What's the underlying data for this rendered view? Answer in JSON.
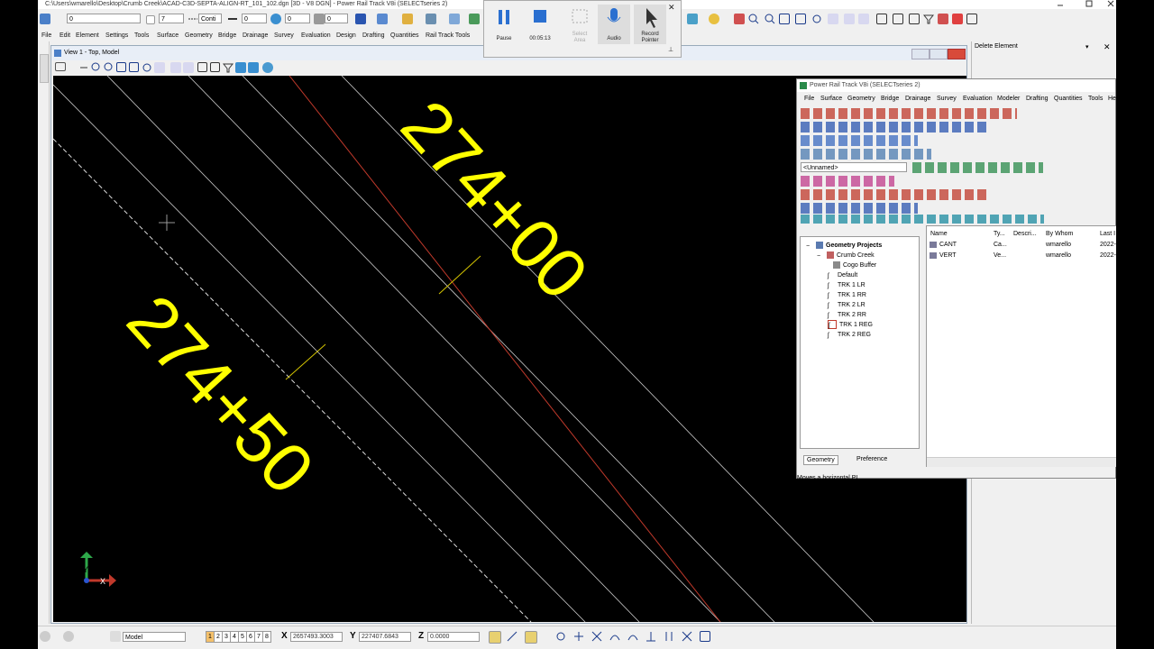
{
  "app": {
    "title": "C:\\Users\\wmarello\\Desktop\\Crumb Creek\\ACAD-C3D-SEPTA-ALIGN-RT_101_102.dgn [3D - V8 DGN] - Power Rail Track V8i (SELECTseries 2)"
  },
  "toolbar": {
    "level_value": "0",
    "color_value": "7",
    "style_value": "Conti",
    "weight_value": "0",
    "trans_value": "0",
    "prio_value": "0"
  },
  "menu": [
    "File",
    "Edit",
    "Element",
    "Settings",
    "Tools",
    "Surface",
    "Geometry",
    "Bridge",
    "Drainage",
    "Survey",
    "Evaluation",
    "Design",
    "Drafting",
    "Quantities",
    "Rail Track Tools"
  ],
  "recorder": {
    "pause": "Pause",
    "time": "00:05:13",
    "select_area_1": "Select",
    "select_area_2": "Area",
    "audio": "Audio",
    "record_pointer_1": "Record",
    "record_pointer_2": "Pointer"
  },
  "view": {
    "title": "View 1 - Top, Model",
    "labels": [
      "274+00",
      "274+50"
    ],
    "colors": {
      "label": "#ffff00",
      "line": "#e8e8e8",
      "red_line": "#c0392b",
      "ticks": "#d4c400"
    }
  },
  "rightpanel": {
    "title": "Delete Element"
  },
  "panel": {
    "title": "Power Rail Track V8i (SELECTseries 2)",
    "menu": [
      "File",
      "Surface",
      "Geometry",
      "Bridge",
      "Drainage",
      "Survey",
      "Evaluation",
      "Modeler",
      "Drafting",
      "Quantities",
      "Tools",
      "He"
    ],
    "combo_value": "<Unnamed>",
    "tree": {
      "root": "Geometry Projects",
      "project": "Crumb Creek",
      "items": [
        "Cogo Buffer",
        "Default",
        "TRK 1 LR",
        "TRK 1 RR",
        "TRK 2 LR",
        "TRK 2 RR",
        "TRK 1 REG",
        "TRK 2 REG"
      ]
    },
    "list": {
      "headers": [
        "Name",
        "Ty...",
        "Descri...",
        "By Whom",
        "Last I"
      ],
      "rows": [
        [
          "CANT",
          "Ca...",
          "",
          "wmarello",
          "2022-"
        ],
        [
          "VERT",
          "Ve...",
          "",
          "wmarello",
          "2022-"
        ]
      ]
    },
    "tabs": [
      "Geometry",
      "Preference"
    ],
    "status": "Moves a horizontal PI"
  },
  "bottom": {
    "model": "Model",
    "views": [
      "1",
      "2",
      "3",
      "4",
      "5",
      "6",
      "7",
      "8"
    ],
    "x_label": "X",
    "x_value": "2657493.3003",
    "y_label": "Y",
    "y_value": "227407.6843",
    "z_label": "Z",
    "z_value": "0.0000"
  }
}
